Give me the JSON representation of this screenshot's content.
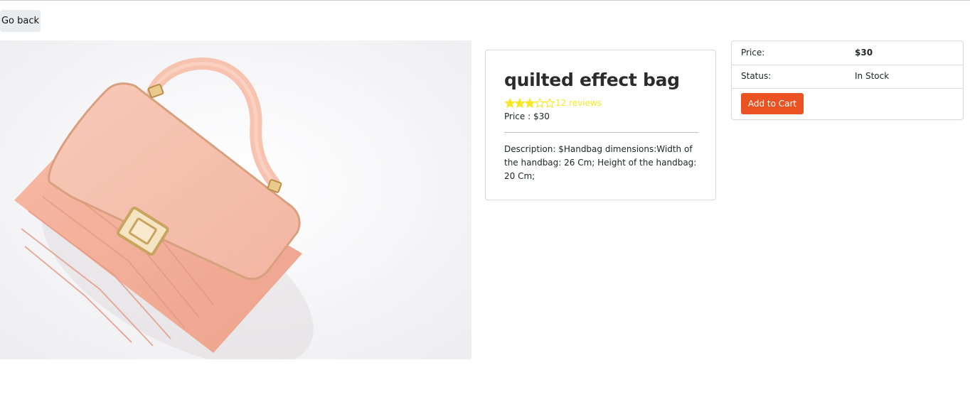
{
  "nav": {
    "back_label": "Go back"
  },
  "product": {
    "image_alt": "Pink quilted effect handbag",
    "title": "quilted effect bag",
    "rating": 3,
    "rating_max": 5,
    "reviews_text": "12 reviews",
    "price_text": "Price : $30",
    "description_text": "Description: $Handbag dimensions:Width of the handbag: 26 Cm; Height of the handbag: 20 Cm;"
  },
  "cart": {
    "price_label": "Price:",
    "price_value": "$30",
    "status_label": "Status:",
    "status_value": "In Stock",
    "add_label": "Add to Cart"
  },
  "colors": {
    "star": "#f8e825",
    "add_button": "#eb5221",
    "back_button": "#e9ecef"
  }
}
